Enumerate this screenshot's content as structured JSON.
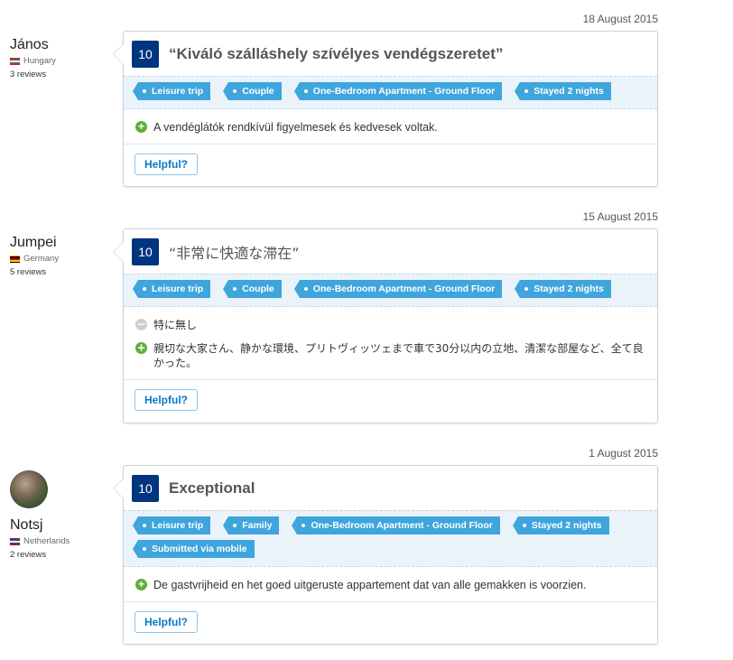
{
  "reviews": [
    {
      "date": "18 August 2015",
      "reviewer": {
        "name": "János",
        "country": "Hungary",
        "reviews": "3 reviews",
        "flag": "hu"
      },
      "score": "10",
      "title": "“Kiváló szálláshely szívélyes vendégszeretet”",
      "tags": [
        "Leisure trip",
        "Couple",
        "One-Bedroom Apartment - Ground Floor",
        "Stayed 2 nights"
      ],
      "positive": "A vendéglátók rendkívül figyelmesek és kedvesek voltak.",
      "helpful_label": "Helpful?"
    },
    {
      "date": "15 August 2015",
      "reviewer": {
        "name": "Jumpei",
        "country": "Germany",
        "reviews": "5 reviews",
        "flag": "de"
      },
      "score": "10",
      "title": "“非常に快適な滞在”",
      "tags": [
        "Leisure trip",
        "Couple",
        "One-Bedroom Apartment - Ground Floor",
        "Stayed 2 nights"
      ],
      "negative": "特に無し",
      "positive": "親切な大家さん、静かな環境、プリトヴィッツェまで車で30分以内の立地、清潔な部屋など、全て良かった。",
      "helpful_label": "Helpful?"
    },
    {
      "date": "1 August 2015",
      "reviewer": {
        "name": "Notsj",
        "country": "Netherlands",
        "reviews": "2 reviews",
        "flag": "nl"
      },
      "score": "10",
      "title": "Exceptional",
      "tags": [
        "Leisure trip",
        "Family",
        "One-Bedroom Apartment - Ground Floor",
        "Stayed 2 nights",
        "Submitted via mobile"
      ],
      "positive": "De gastvrijheid en het goed uitgeruste appartement dat van alle gemakken is voorzien.",
      "helpful_label": "Helpful?"
    }
  ],
  "colors": {
    "score_bg": "#003580",
    "tag_bg": "#3fa5dd",
    "tags_band": "#ebf3fa",
    "positive": "#5fae3b",
    "neutral": "#cfcfcf",
    "link": "#0a77c8"
  },
  "icons": {
    "positive": "plus-circle-icon",
    "negative": "minus-circle-icon",
    "tag": "tag-icon"
  }
}
